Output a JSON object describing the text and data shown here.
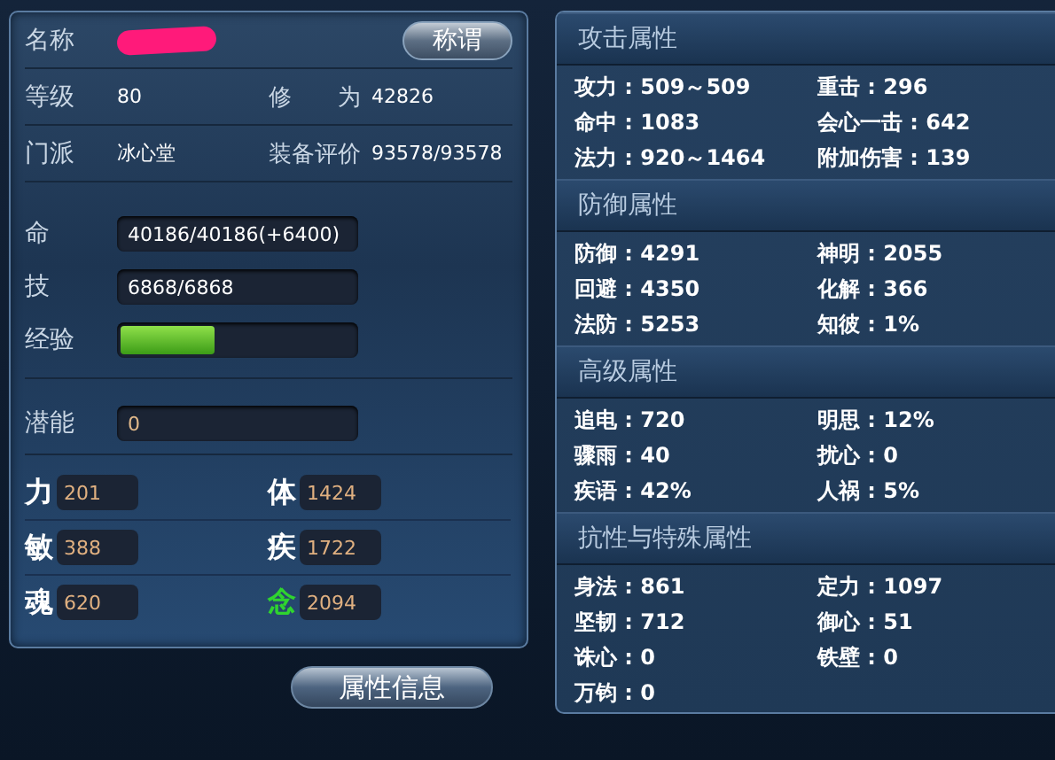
{
  "profile": {
    "name_label": "名称",
    "name_redacted": true,
    "title_button": "称谓",
    "info_rows": [
      [
        {
          "label": "等级",
          "value": "80"
        },
        {
          "label": "修　　为",
          "value": "42826"
        }
      ],
      [
        {
          "label": "门派",
          "value": "冰心堂"
        },
        {
          "label": "装备评价",
          "value": "93578/93578"
        }
      ]
    ]
  },
  "bars": [
    {
      "kind": "text",
      "label": "命",
      "value": "40186/40186(+6400)"
    },
    {
      "kind": "text",
      "label": "技",
      "value": "6868/6868"
    },
    {
      "kind": "progress",
      "label": "经验",
      "level": 0.4
    }
  ],
  "potential": {
    "label": "潜能",
    "value": "0"
  },
  "stats": [
    {
      "label": "力",
      "value": "201",
      "highlight": false
    },
    {
      "label": "体",
      "value": "1424",
      "highlight": false
    },
    {
      "label": "敏",
      "value": "388",
      "highlight": false
    },
    {
      "label": "疾",
      "value": "1722",
      "highlight": false
    },
    {
      "label": "魂",
      "value": "620",
      "highlight": false
    },
    {
      "label": "念",
      "value": "2094",
      "highlight": true
    }
  ],
  "attributes_button": "属性信息",
  "sections": [
    {
      "title": "攻击属性",
      "items": [
        "攻力 : 509～509",
        "重击 : 296",
        "命中 : 1083",
        "会心一击 : 642",
        "法力 : 920～1464",
        "附加伤害 : 139"
      ]
    },
    {
      "title": "防御属性",
      "items": [
        "防御 : 4291",
        "神明 : 2055",
        "回避 : 4350",
        "化解 : 366",
        "法防 : 5253",
        "知彼 : 1%"
      ]
    },
    {
      "title": "高级属性",
      "items": [
        "追电 : 720",
        "明思 : 12%",
        "骤雨 : 40",
        "扰心 : 0",
        "疾语 : 42%",
        "人祸 : 5%"
      ]
    },
    {
      "title": "抗性与特殊属性",
      "items": [
        "身法 : 861",
        "定力 : 1097",
        "坚韧 : 712",
        "御心 : 51",
        "诛心 : 0",
        "铁壁 : 0",
        "万钧 : 0"
      ]
    }
  ]
}
